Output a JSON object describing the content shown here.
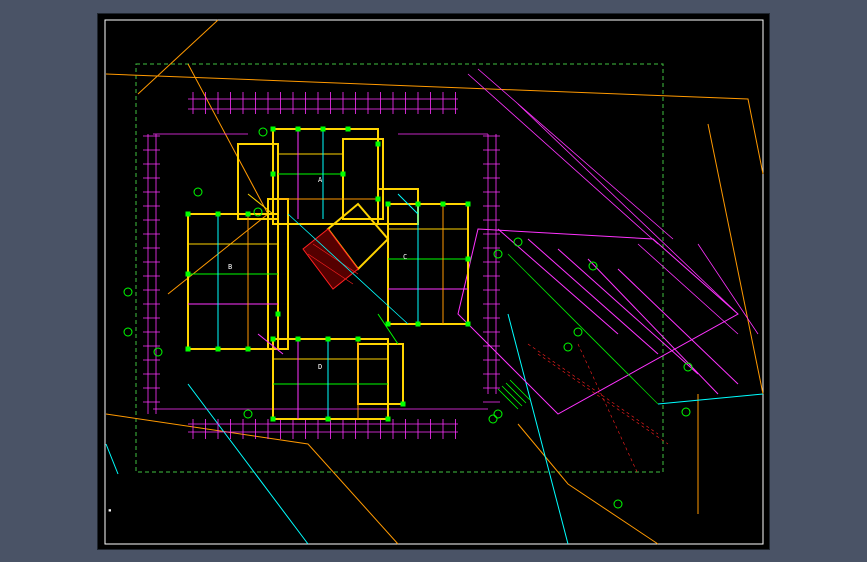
{
  "drawing": {
    "colors": {
      "background": "#000000",
      "frame": "#ffffff",
      "axis_magenta": "#ff00ff",
      "wall_yellow": "#ffd400",
      "column_green": "#00ff00",
      "orange_boundary": "#ff9900",
      "cyan_line": "#00ffff",
      "red_hatch": "#ff2020",
      "dashed_green": "#44cc44"
    },
    "annotations": [
      {
        "name": "room-label",
        "text": "A"
      },
      {
        "name": "room-label",
        "text": "B"
      },
      {
        "name": "room-label",
        "text": "C"
      },
      {
        "name": "room-label",
        "text": "D"
      }
    ]
  }
}
